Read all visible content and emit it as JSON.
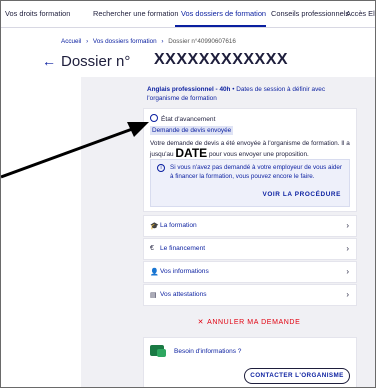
{
  "topnav": {
    "tabs": [
      {
        "label": "Vos droits formation"
      },
      {
        "label": "Rechercher une formation"
      },
      {
        "label": "Vos dossiers de formation"
      },
      {
        "label": "Conseils professionnels"
      },
      {
        "label": "Accès Elus"
      }
    ],
    "active_tab": "Vos dossiers de formation"
  },
  "breadcrumb": {
    "items": [
      "Accueil",
      "Vos dossiers formation",
      "Dossier n°40990607616"
    ]
  },
  "header": {
    "back_icon": "arrow-left-icon",
    "title": "Dossier n°",
    "number": "XXXXXXXXXXXX"
  },
  "course": {
    "name": "Anglais professionnel - 40h",
    "details": " • Dates de session à définir avec l'organisme de formation"
  },
  "status": {
    "heading": "État d'avancement",
    "badge": "Demande de devis envoyée",
    "desc_before": "Votre demande de devis a été envoyée à l'organisme de formation. Il a jusqu'au ",
    "date_placeholder": "DATE",
    "desc_after": " pour vous envoyer une proposition.",
    "info_text": "Si vous n'avez pas demandé à votre employeur de vous aider à financer la formation, vous pouvez encore le faire.",
    "procedure_label": "VOIR LA PROCÉDURE"
  },
  "sections": [
    {
      "icon": "graduation-cap-icon",
      "label": "La formation"
    },
    {
      "icon": "euro-icon",
      "label": "Le financement"
    },
    {
      "icon": "user-icon",
      "label": "Vos informations"
    },
    {
      "icon": "document-icon",
      "label": "Vos attestations"
    }
  ],
  "cancel_label": "ANNULER MA DEMANDE",
  "help": {
    "title": "Besoin d'informations ?",
    "contact_label": "CONTACTER L'ORGANISME"
  },
  "colors": {
    "primary": "#0a1fa0",
    "danger": "#e1000f",
    "panel_bg": "#f0f0f4",
    "help_icon": "#1a7a44"
  }
}
